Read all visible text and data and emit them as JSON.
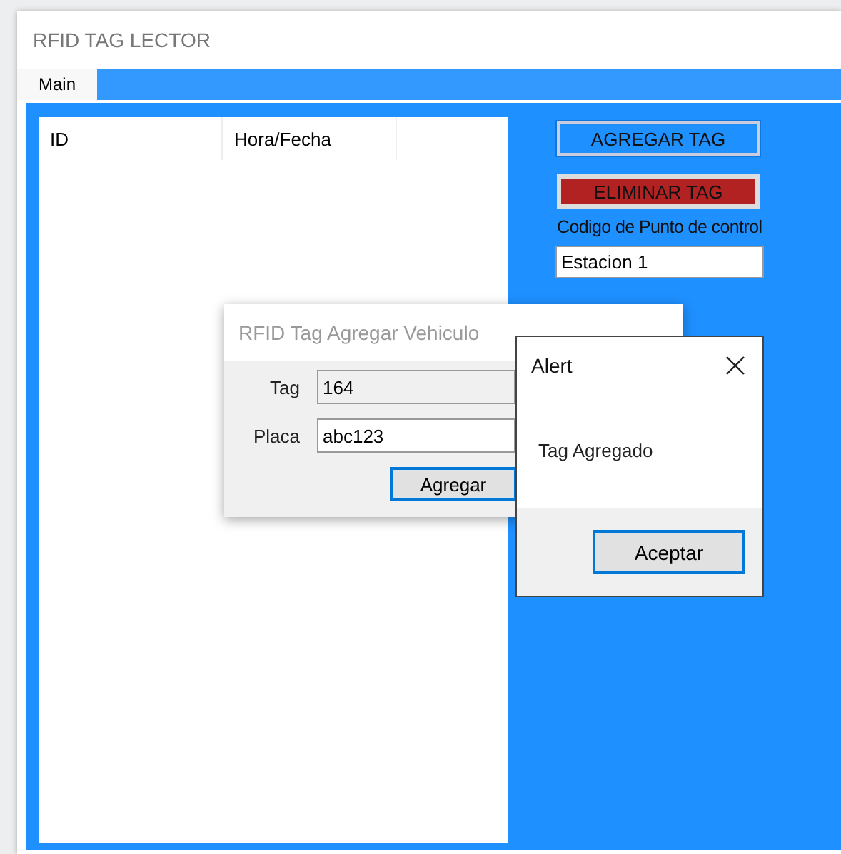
{
  "window": {
    "title": "RFID TAG LECTOR"
  },
  "tabs": [
    {
      "label": "Main",
      "selected": true
    }
  ],
  "list": {
    "columns": [
      "ID",
      "Hora/Fecha"
    ]
  },
  "buttons": [
    {
      "label": "AGREGAR TAG",
      "kind": "add"
    },
    {
      "label": "ELIMINAR TAG",
      "kind": "delete"
    }
  ],
  "checkpoint": {
    "label": "Codigo de Punto de control",
    "value": "Estacion 1"
  },
  "add_dialog": {
    "title": "RFID Tag Agregar Vehiculo",
    "fields": [
      {
        "label": "Tag",
        "value": "164",
        "disabled": true
      },
      {
        "label": "Placa",
        "value": "abc123",
        "disabled": false
      }
    ],
    "button": "Agregar"
  },
  "alert": {
    "title": "Alert",
    "message": "Tag Agregado",
    "button": "Aceptar"
  }
}
